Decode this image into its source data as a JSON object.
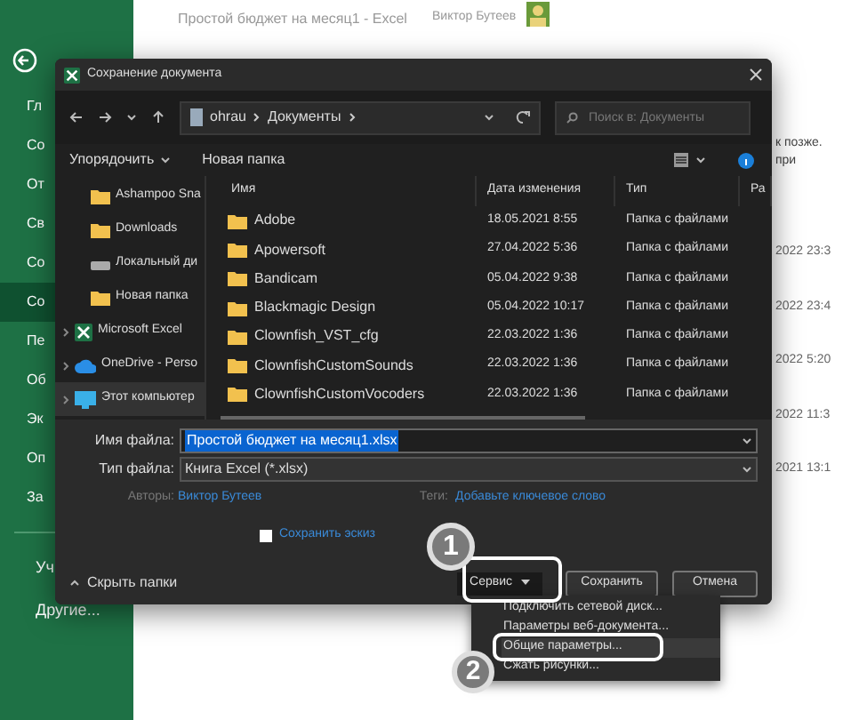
{
  "excel": {
    "title": "Простой бюджет на месяц1  -  Excel",
    "user": "Виктор Бутеев",
    "sidebar": [
      {
        "label": "Гл",
        "selected": false
      },
      {
        "label": "Со",
        "selected": false
      },
      {
        "label": "От",
        "selected": false
      },
      {
        "label": "Св",
        "selected": false
      },
      {
        "label": "Со",
        "selected": false
      },
      {
        "label": "Со",
        "selected": true
      },
      {
        "label": "Пе",
        "selected": false
      },
      {
        "label": "Об",
        "selected": false
      },
      {
        "label": "Эк",
        "selected": false
      },
      {
        "label": "Оп",
        "selected": false
      },
      {
        "label": "За",
        "selected": false
      }
    ],
    "sidebar_bottom": [
      "Уч",
      "Другие..."
    ],
    "right_texts": [
      "к позже.",
      "при"
    ],
    "right_dates": [
      "2022 23:3",
      "2022 23:4",
      "2022 5:20",
      "2022 11:3",
      "2021 13:1"
    ]
  },
  "dialog": {
    "title": "Сохранение документа",
    "path": [
      "ohrau",
      "Документы"
    ],
    "search": {
      "placeholder": "Поиск в: Документы"
    },
    "commands": [
      "Упорядочить",
      "Новая папка"
    ],
    "nav": [
      {
        "label": "Ashampoo Sna",
        "kind": "folder",
        "selected": false
      },
      {
        "label": "Downloads",
        "kind": "folder",
        "selected": false
      },
      {
        "label": "Локальный ди",
        "kind": "drive",
        "selected": false
      },
      {
        "label": "Новая папка",
        "kind": "folder",
        "selected": false
      },
      {
        "label": "Microsoft Excel",
        "kind": "excel",
        "selected": false
      },
      {
        "label": "OneDrive - Perso",
        "kind": "cloud",
        "selected": false
      },
      {
        "label": "Этот компьютер",
        "kind": "pc",
        "selected": true
      }
    ],
    "columns": [
      "Имя",
      "Дата изменения",
      "Тип",
      "Ра"
    ],
    "rows": [
      {
        "name": "Adobe",
        "date": "18.05.2021 8:55",
        "type": "Папка с файлами"
      },
      {
        "name": "Apowersoft",
        "date": "27.04.2022 5:36",
        "type": "Папка с файлами"
      },
      {
        "name": "Bandicam",
        "date": "05.04.2022 9:38",
        "type": "Папка с файлами"
      },
      {
        "name": "Blackmagic Design",
        "date": "05.04.2022 10:17",
        "type": "Папка с файлами"
      },
      {
        "name": "Clownfish_VST_cfg",
        "date": "22.03.2022 1:36",
        "type": "Папка с файлами"
      },
      {
        "name": "ClownfishCustomSounds",
        "date": "22.03.2022 1:36",
        "type": "Папка с файлами"
      },
      {
        "name": "ClownfishCustomVocoders",
        "date": "22.03.2022 1:36",
        "type": "Папка с файлами"
      }
    ],
    "filename": {
      "label": "Имя файла:",
      "value": "Простой бюджет на месяц1.xlsx"
    },
    "filetype": {
      "label": "Тип файла:",
      "value": "Книга Excel (*.xlsx)"
    },
    "authors": {
      "label": "Авторы:",
      "value": "Виктор Бутеев"
    },
    "tags": {
      "label": "Теги:",
      "value": "Добавьте ключевое слово"
    },
    "thumbnail": {
      "label": "Сохранить эскиз",
      "checked": false
    },
    "hide_folders": "Скрыть папки",
    "buttons": {
      "service": "Сервис",
      "save": "Сохранить",
      "cancel": "Отмена"
    },
    "menu": [
      {
        "label": "Подключить сетевой диск...",
        "selected": false
      },
      {
        "label": "Параметры веб-документа...",
        "selected": false
      },
      {
        "label": "Общие параметры...",
        "selected": true
      },
      {
        "label": "Сжать рисунки...",
        "selected": false
      }
    ]
  },
  "callouts": [
    "1",
    "2"
  ]
}
